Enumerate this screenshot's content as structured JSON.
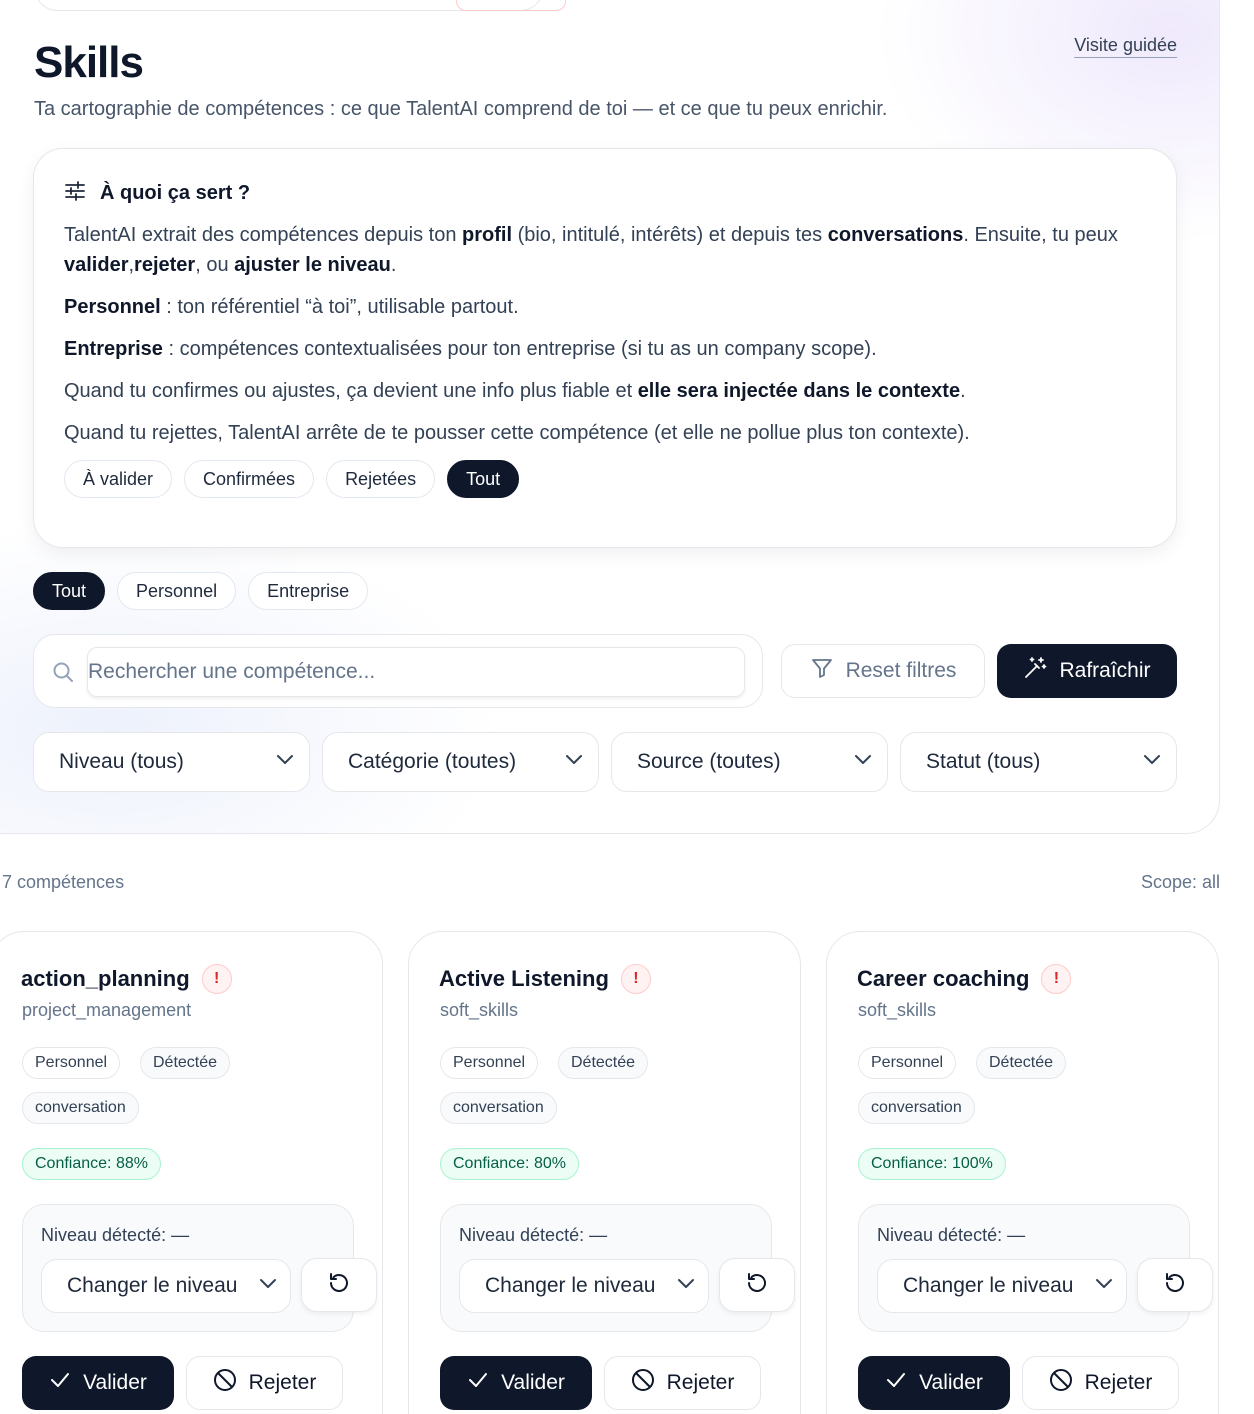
{
  "header": {
    "title": "Skills",
    "tour_link": "Visite guidée",
    "subtitle": "Ta cartographie de compétences : ce que TalentAI comprend de toi — et ce que tu peux enrichir."
  },
  "info": {
    "heading": "À quoi ça sert ?",
    "p1": {
      "a": "TalentAI extrait des compétences depuis ton ",
      "b": "profil",
      "c": " (bio, intitulé, intérêts) et depuis tes ",
      "d": "conversations",
      "e": ". Ensuite, tu peux ",
      "f": "valider",
      "g": ",",
      "h": "rejeter",
      "i": ", ou ",
      "j": "ajuster le niveau",
      "k": "."
    },
    "p2": {
      "b": "Personnel",
      "t": " : ton référentiel “à toi”, utilisable partout."
    },
    "p3": {
      "b": "Entreprise",
      "t": " : compétences contextualisées pour ton entreprise (si tu as un company scope)."
    },
    "p4": {
      "t": "Quand tu confirmes ou ajustes, ça devient une info plus fiable et ",
      "b": "elle sera injectée dans le contexte",
      "e": "."
    },
    "p5": "Quand tu rejettes, TalentAI arrête de te pousser cette compétence (et elle ne pollue plus ton contexte).",
    "status_filters": [
      "À valider",
      "Confirmées",
      "Rejetées",
      "Tout"
    ],
    "status_active": "Tout"
  },
  "scope_filters": [
    "Tout",
    "Personnel",
    "Entreprise"
  ],
  "scope_active": "Tout",
  "search": {
    "placeholder": "Rechercher une compétence...",
    "value": ""
  },
  "buttons": {
    "reset": "Reset filtres",
    "refresh": "Rafraîchir"
  },
  "selects": [
    "Niveau (tous)",
    "Catégorie (toutes)",
    "Source (toutes)",
    "Statut (tous)"
  ],
  "summary": {
    "count": "7 compétences",
    "scope": "Scope: all"
  },
  "skills": [
    {
      "name": "action_planning",
      "category": "project_management",
      "tags": [
        "Personnel",
        "Détectée",
        "conversation"
      ],
      "confidence": "Confiance: 88%",
      "level_label": "Niveau détecté: —",
      "level_select": "Changer le niveau",
      "validate": "Valider",
      "reject": "Rejeter"
    },
    {
      "name": "Active Listening",
      "category": "soft_skills",
      "tags": [
        "Personnel",
        "Détectée",
        "conversation"
      ],
      "confidence": "Confiance: 80%",
      "level_label": "Niveau détecté: —",
      "level_select": "Changer le niveau",
      "validate": "Valider",
      "reject": "Rejeter"
    },
    {
      "name": "Career coaching",
      "category": "soft_skills",
      "tags": [
        "Personnel",
        "Détectée",
        "conversation"
      ],
      "confidence": "Confiance: 100%",
      "level_label": "Niveau détecté: —",
      "level_select": "Changer le niveau",
      "validate": "Valider",
      "reject": "Rejeter"
    }
  ],
  "warning_symbol": "!",
  "colors": {
    "primary": "#0f172a",
    "confidence_bg": "#ecfdf5",
    "confidence_text": "#065f46",
    "warning": "#dc2626"
  }
}
